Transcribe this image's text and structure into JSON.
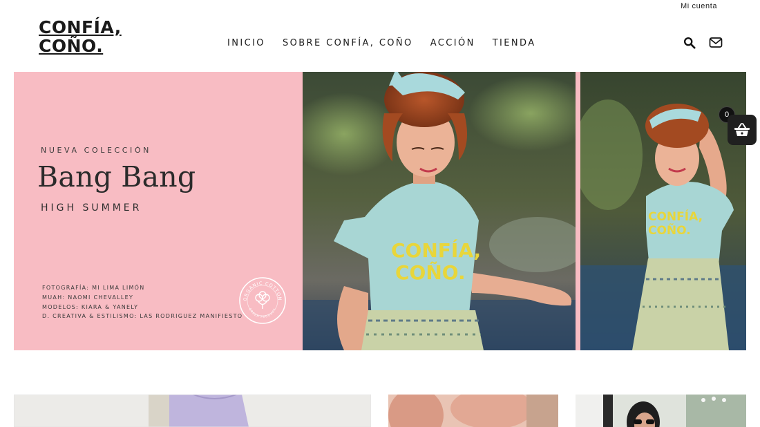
{
  "header": {
    "account_link": "Mi cuenta",
    "logo_line1": "CONFÍA,",
    "logo_line2": "COÑO.",
    "nav": [
      "INICIO",
      "SOBRE CONFÍA, COÑO",
      "ACCIÓN",
      "TIENDA"
    ],
    "icons": [
      "search-icon",
      "mail-icon"
    ]
  },
  "hero": {
    "kicker": "NUEVA COLECCIÓN",
    "title": "Bang Bang",
    "subtitle": "HIGH SUMMER",
    "credits": [
      "FOTOGRAFÍA: MI LIMA LIMÓN",
      "MUAH: NAOMI CHEVALLEY",
      "MODELOS: KIARA & YANELY",
      "D. CREATIVA & ESTILISMO: LAS RODRIGUEZ MANIFIESTO"
    ],
    "badge_top": "ORGANIC COTTON",
    "badge_bottom": "GREEN PRODUCT",
    "shirt_line1": "CONFÍA,",
    "shirt_line2": "COÑO.",
    "panel_color": "#f8bcc3"
  },
  "cart": {
    "count": "0",
    "icon": "basket-icon"
  },
  "tiles": [
    "lavender-shirt-photo",
    "pink-photo",
    "sunglasses-portrait-photo"
  ]
}
